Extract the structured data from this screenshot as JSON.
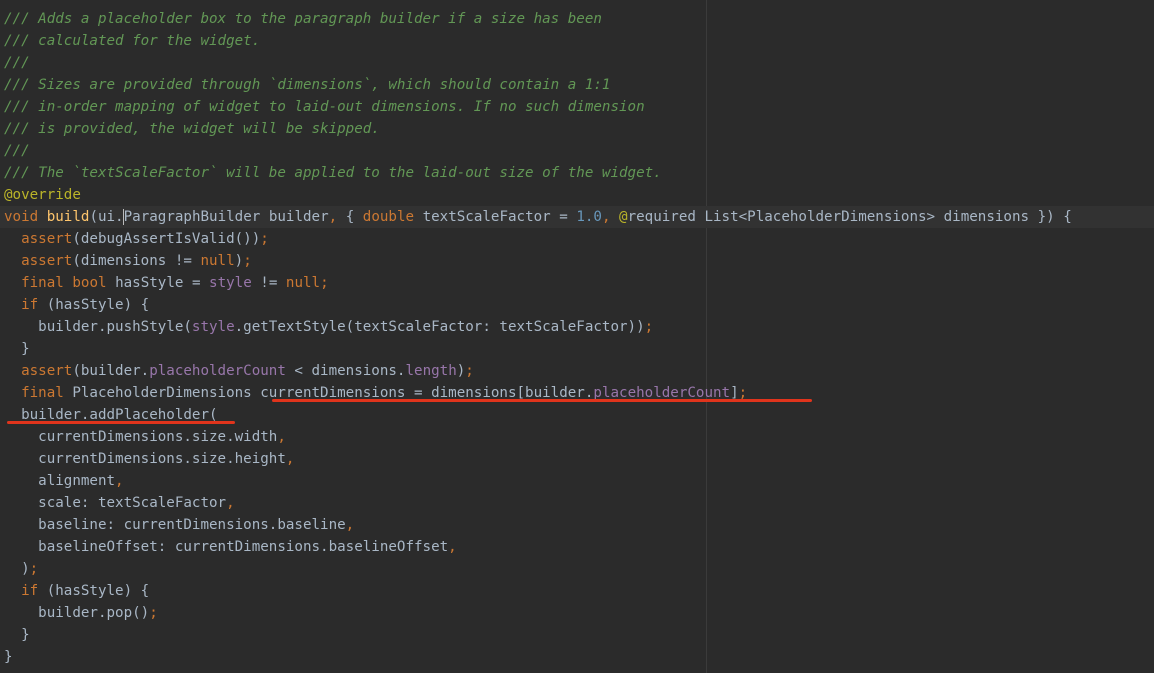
{
  "editor": {
    "lines": [
      "/// Adds a placeholder box to the paragraph builder if a size has been",
      "/// calculated for the widget.",
      "///",
      "/// Sizes are provided through `dimensions`, which should contain a 1:1",
      "/// in-order mapping of widget to laid-out dimensions. If no such dimension",
      "/// is provided, the widget will be skipped.",
      "///",
      "/// The `textScaleFactor` will be applied to the laid-out size of the widget.",
      "@override",
      "void build(ui.ParagraphBuilder builder, { double textScaleFactor = 1.0, @required List<PlaceholderDimensions> dimensions }) {",
      "  assert(debugAssertIsValid());",
      "  assert(dimensions != null);",
      "  final bool hasStyle = style != null;",
      "  if (hasStyle) {",
      "    builder.pushStyle(style.getTextStyle(textScaleFactor: textScaleFactor));",
      "  }",
      "  assert(builder.placeholderCount < dimensions.length);",
      "  final PlaceholderDimensions currentDimensions = dimensions[builder.placeholderCount];",
      "  builder.addPlaceholder(",
      "    currentDimensions.size.width,",
      "    currentDimensions.size.height,",
      "    alignment,",
      "    scale: textScaleFactor,",
      "    baseline: currentDimensions.baseline,",
      "    baselineOffset: currentDimensions.baselineOffset,",
      "  );",
      "  if (hasStyle) {",
      "    builder.pop();",
      "  }",
      "}"
    ],
    "colors": {
      "background": "#2b2b2b",
      "comment": "#629755",
      "keyword": "#cc7832",
      "annotation": "#bbb529",
      "function": "#ffc66d",
      "field": "#9876aa",
      "number": "#6897bb",
      "text": "#a9b7c6",
      "underline": "#e0341c"
    }
  }
}
